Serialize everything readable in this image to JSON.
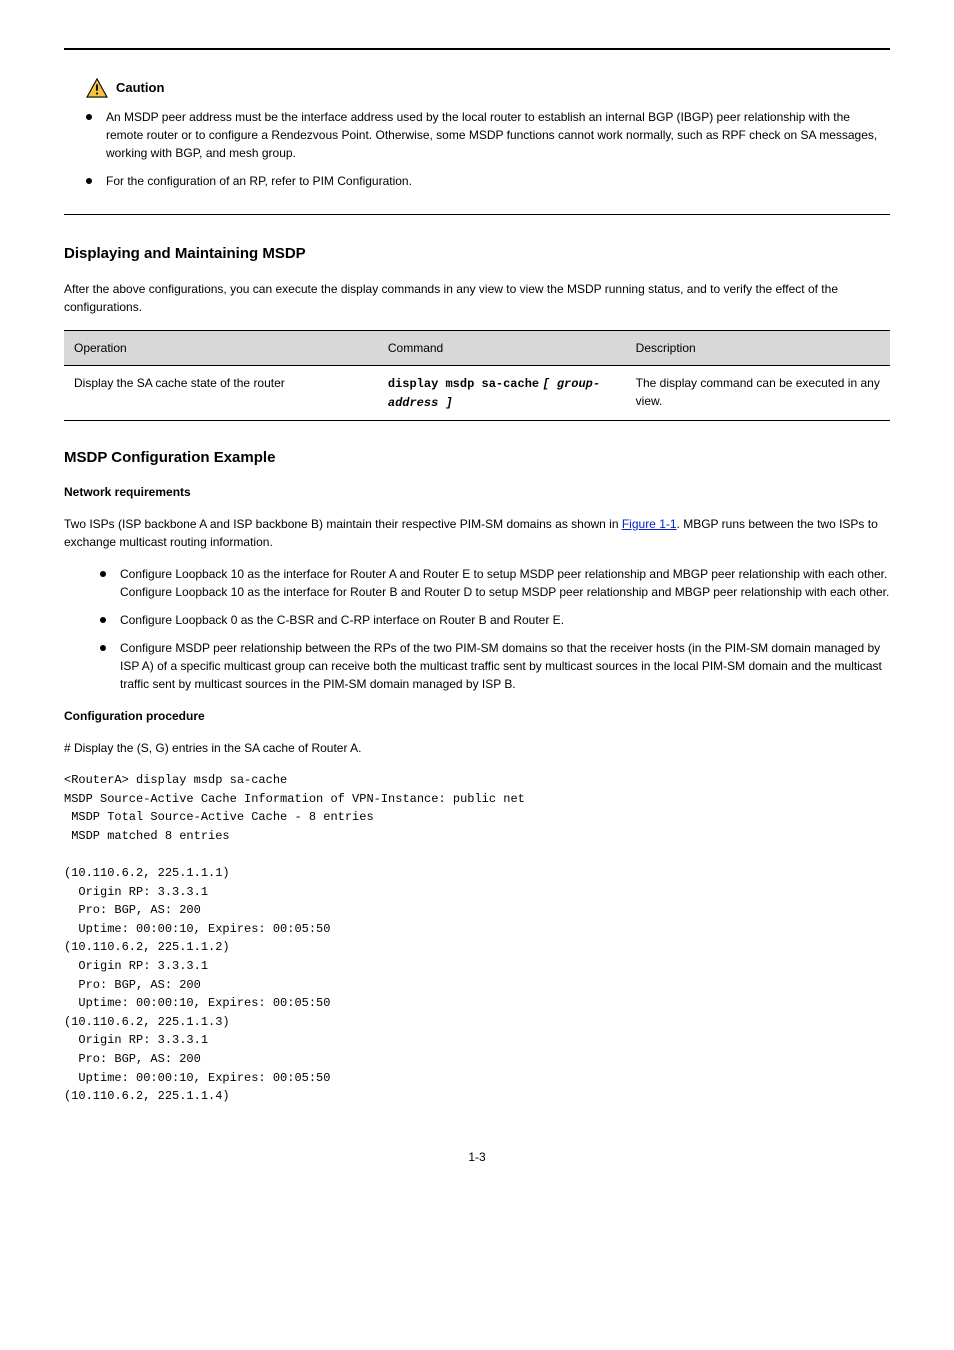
{
  "caution": {
    "label": "Caution",
    "items": [
      "An MSDP peer address must be the interface address used by the local router to establish an internal BGP (IBGP) peer relationship with the remote router or to configure a Rendezvous Point. Otherwise, some MSDP functions cannot work normally, such as RPF check on SA messages, working with BGP, and mesh group.",
      "For the configuration of an RP, refer to PIM Configuration."
    ]
  },
  "display": {
    "heading": "Displaying and Maintaining MSDP",
    "intro": "After the above configurations, you can execute the display commands in any view to view the MSDP running status, and to verify the effect of the configurations.",
    "table": {
      "headers": [
        "Operation",
        "Command",
        "Description"
      ],
      "row": {
        "op": "Display the SA cache state of the router",
        "cmd_prefix": "display msdp",
        "cmd_suffix": "sa-cache",
        "cmd_arg": "[ group-address ]",
        "desc": "The display command can be executed in any view."
      }
    }
  },
  "example": {
    "heading": "MSDP Configuration Example",
    "req_head": "Network requirements",
    "req_intro_1": "Two ISPs (ISP backbone A and ISP backbone B) maintain their respective PIM-SM domains as shown in ",
    "req_intro_link": "Figure 1-1",
    "req_intro_2": ". MBGP runs between the two ISPs to exchange multicast routing information.",
    "bullets": [
      "Configure Loopback 10 as the interface for Router A and Router E to setup MSDP peer relationship and MBGP peer relationship with each other. Configure Loopback 10 as the interface for Router B and Router D to setup MSDP peer relationship and MBGP peer relationship with each other.",
      "Configure Loopback 0 as the C-BSR and C-RP interface on Router B and Router E.",
      "Configure MSDP peer relationship between the RPs of the two PIM-SM domains so that the receiver hosts (in the PIM-SM domain managed by ISP A) of a specific multicast group can receive both the multicast traffic sent by multicast sources in the local PIM-SM domain and the multicast traffic sent by multicast sources in the PIM-SM domain managed by ISP B."
    ],
    "cfg_head": "Configuration procedure",
    "cfg_intro": "# Display the (S, G) entries in the SA cache of Router A.",
    "cli_cmd": "<RouterA> display msdp sa-cache",
    "cli_out": "MSDP Source-Active Cache Information of VPN-Instance: public net\n MSDP Total Source-Active Cache - 8 entries\n MSDP matched 8 entries\n\n(10.110.6.2, 225.1.1.1)\n  Origin RP: 3.3.3.1\n  Pro: BGP, AS: 200\n  Uptime: 00:00:10, Expires: 00:05:50\n(10.110.6.2, 225.1.1.2)\n  Origin RP: 3.3.3.1\n  Pro: BGP, AS: 200\n  Uptime: 00:00:10, Expires: 00:05:50\n(10.110.6.2, 225.1.1.3)\n  Origin RP: 3.3.3.1\n  Pro: BGP, AS: 200\n  Uptime: 00:00:10, Expires: 00:05:50\n(10.110.6.2, 225.1.1.4)"
  },
  "page_number": "1-3"
}
